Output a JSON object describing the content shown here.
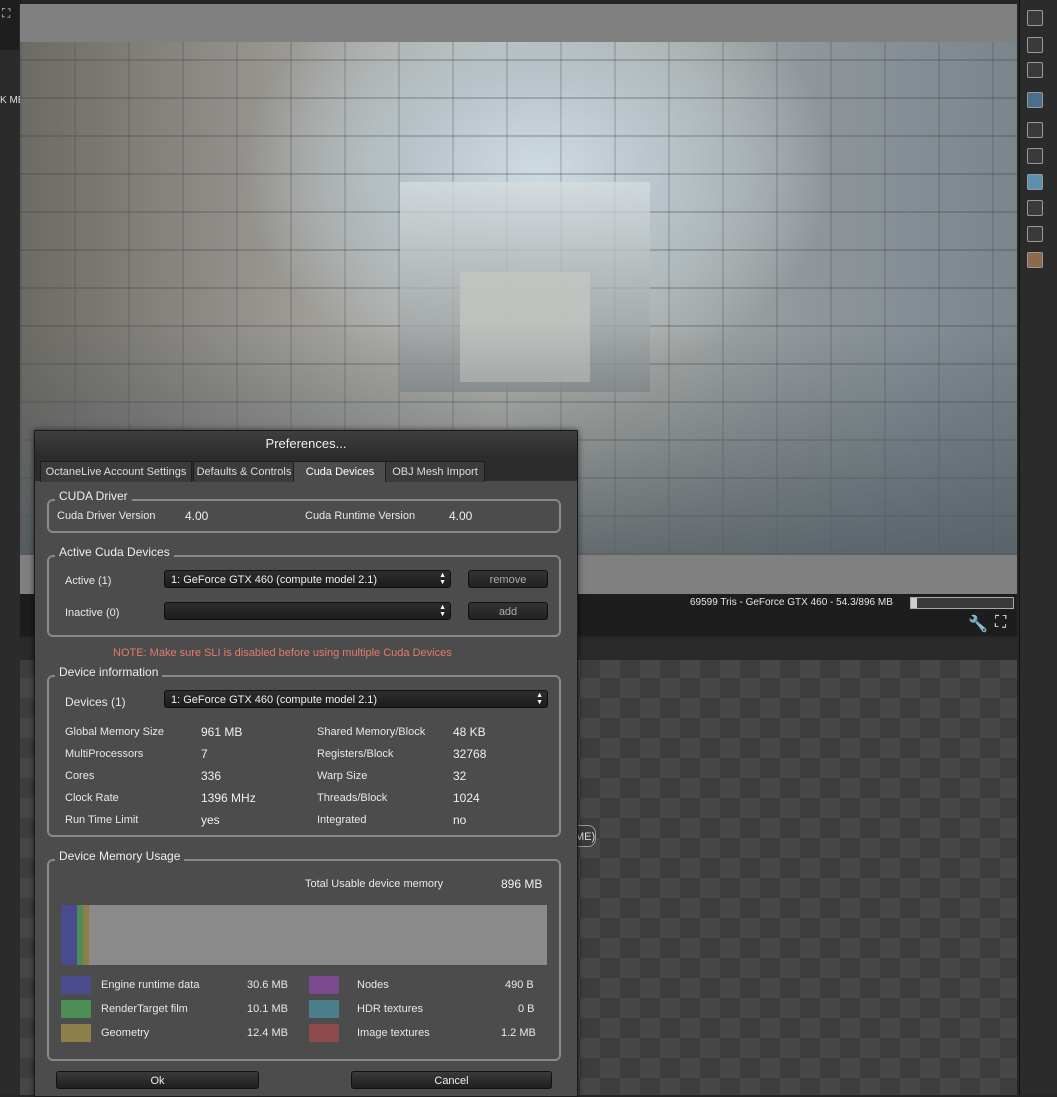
{
  "viewport": {
    "status": "69599 Tris - GeForce GTX 460 - 54.3/896 MB",
    "memory_fraction": 0.06
  },
  "left_panel": {
    "label": "K ME"
  },
  "node_editor": {
    "pill_text": "ME)"
  },
  "dialog": {
    "title": "Preferences...",
    "tabs": [
      "OctaneLive Account Settings",
      "Defaults & Controls",
      "Cuda Devices",
      "OBJ Mesh Import"
    ],
    "active_tab": "Cuda Devices",
    "cuda_driver": {
      "legend": "CUDA Driver",
      "driver_label": "Cuda Driver Version",
      "driver_value": "4.00",
      "runtime_label": "Cuda Runtime Version",
      "runtime_value": "4.00"
    },
    "active_devices": {
      "legend": "Active Cuda Devices",
      "active_label": "Active (1)",
      "active_value": "1: GeForce GTX 460 (compute model 2.1)",
      "remove_label": "remove",
      "inactive_label": "Inactive (0)",
      "inactive_value": "",
      "add_label": "add"
    },
    "note": "NOTE: Make sure SLI is disabled before using multiple Cuda Devices",
    "device_info": {
      "legend": "Device information",
      "devices_label": "Devices (1)",
      "devices_value": "1: GeForce GTX 460 (compute model 2.1)",
      "rows_left": [
        {
          "label": "Global Memory Size",
          "value": "961 MB"
        },
        {
          "label": "MultiProcessors",
          "value": "7"
        },
        {
          "label": "Cores",
          "value": "336"
        },
        {
          "label": "Clock Rate",
          "value": "1396 MHz"
        },
        {
          "label": "Run Time Limit",
          "value": "yes"
        }
      ],
      "rows_right": [
        {
          "label": "Shared Memory/Block",
          "value": "48 KB"
        },
        {
          "label": "Registers/Block",
          "value": "32768"
        },
        {
          "label": "Warp Size",
          "value": "32"
        },
        {
          "label": "Threads/Block",
          "value": "1024"
        },
        {
          "label": "Integrated",
          "value": "no"
        }
      ]
    },
    "memory_usage": {
      "legend": "Device Memory Usage",
      "total_label": "Total Usable device memory",
      "total_value": "896 MB",
      "items_left": [
        {
          "label": "Engine runtime data",
          "value": "30.6 MB",
          "color": "#4a4a8e"
        },
        {
          "label": "RenderTarget film",
          "value": "10.1 MB",
          "color": "#4a8e55"
        },
        {
          "label": "Geometry",
          "value": "12.4 MB",
          "color": "#8e7e4a"
        }
      ],
      "items_right": [
        {
          "label": "Nodes",
          "value": "490 B",
          "color": "#7a4a8e"
        },
        {
          "label": "HDR textures",
          "value": "0 B",
          "color": "#4a808e"
        },
        {
          "label": "Image textures",
          "value": "1.2 MB",
          "color": "#8e4a4a"
        }
      ]
    },
    "ok_label": "Ok",
    "cancel_label": "Cancel"
  }
}
